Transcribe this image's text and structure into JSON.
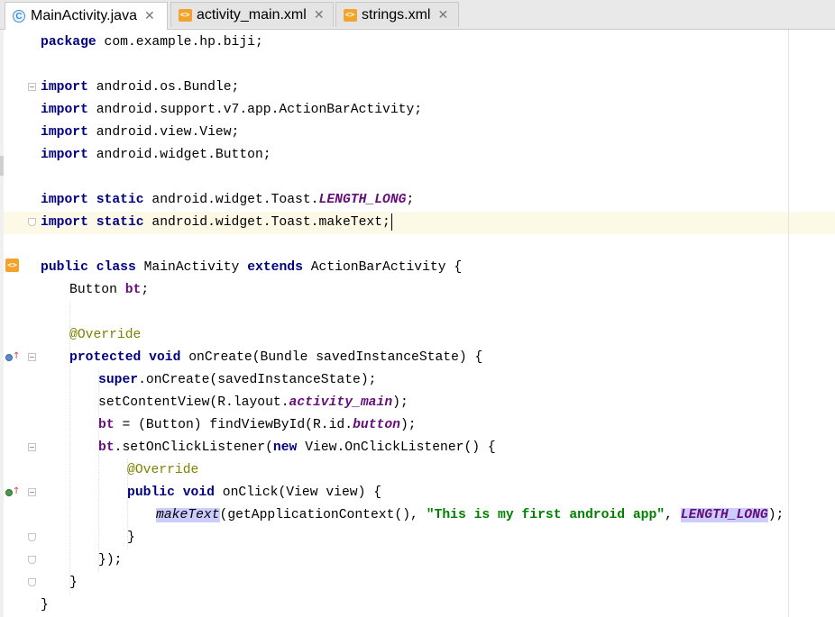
{
  "tabs": [
    {
      "label": "MainActivity.java",
      "icon": "java-class-icon",
      "active": true
    },
    {
      "label": "activity_main.xml",
      "icon": "xml-file-icon",
      "active": false
    },
    {
      "label": "strings.xml",
      "icon": "xml-file-icon",
      "active": false
    }
  ],
  "close_glyph": "✕",
  "code": {
    "l1": {
      "kw": "package",
      "rest": " com.example.hp.biji;"
    },
    "l3": {
      "kw": "import",
      "rest": " android.os.Bundle;"
    },
    "l4": {
      "kw": "import",
      "rest": " android.support.v7.app.ActionBarActivity;"
    },
    "l5": {
      "kw": "import",
      "rest": " android.view.View;"
    },
    "l6": {
      "kw": "import",
      "rest": " android.widget.Button;"
    },
    "l8": {
      "kw": "import static",
      "pre": " android.widget.Toast.",
      "const": "LENGTH_LONG",
      "end": ";"
    },
    "l9": {
      "kw": "import static",
      "pre": " android.widget.Toast.makeText;"
    },
    "l11": {
      "kw1": "public class",
      "name": " MainActivity ",
      "kw2": "extends",
      "rest": " ActionBarActivity {"
    },
    "l12": {
      "type": "Button ",
      "field": "bt",
      "end": ";"
    },
    "l14": {
      "anno": "@Override"
    },
    "l15": {
      "kw": "protected void",
      "rest": " onCreate(Bundle savedInstanceState) {"
    },
    "l16": {
      "kw": "super",
      "rest": ".onCreate(savedInstanceState);"
    },
    "l17": {
      "pre": "setContentView(R.layout.",
      "const": "activity_main",
      "end": ");"
    },
    "l18": {
      "field": "bt",
      "pre": " = (Button) findViewById(R.id.",
      "const": "button",
      "end": ");"
    },
    "l19": {
      "field": "bt",
      "pre": ".setOnClickListener(",
      "kw": "new",
      "rest": " View.OnClickListener() {"
    },
    "l20": {
      "anno": "@Override"
    },
    "l21": {
      "kw": "public void",
      "rest": " onClick(View view) {"
    },
    "l22": {
      "call": "makeText",
      "pre": "(getApplicationContext(), ",
      "str": "\"This is my first android app\"",
      "mid": ", ",
      "const": "LENGTH_LONG",
      "end": ");"
    },
    "l23": {
      "text": "}"
    },
    "l24": {
      "text": "});"
    },
    "l25": {
      "text": "}"
    },
    "l26": {
      "text": "}"
    }
  },
  "colors": {
    "keyword": "#000080",
    "annotation": "#808000",
    "string": "#008000",
    "constant": "#660e7a",
    "highlight": "#ccccff",
    "caret_row": "#fdf9e7"
  }
}
